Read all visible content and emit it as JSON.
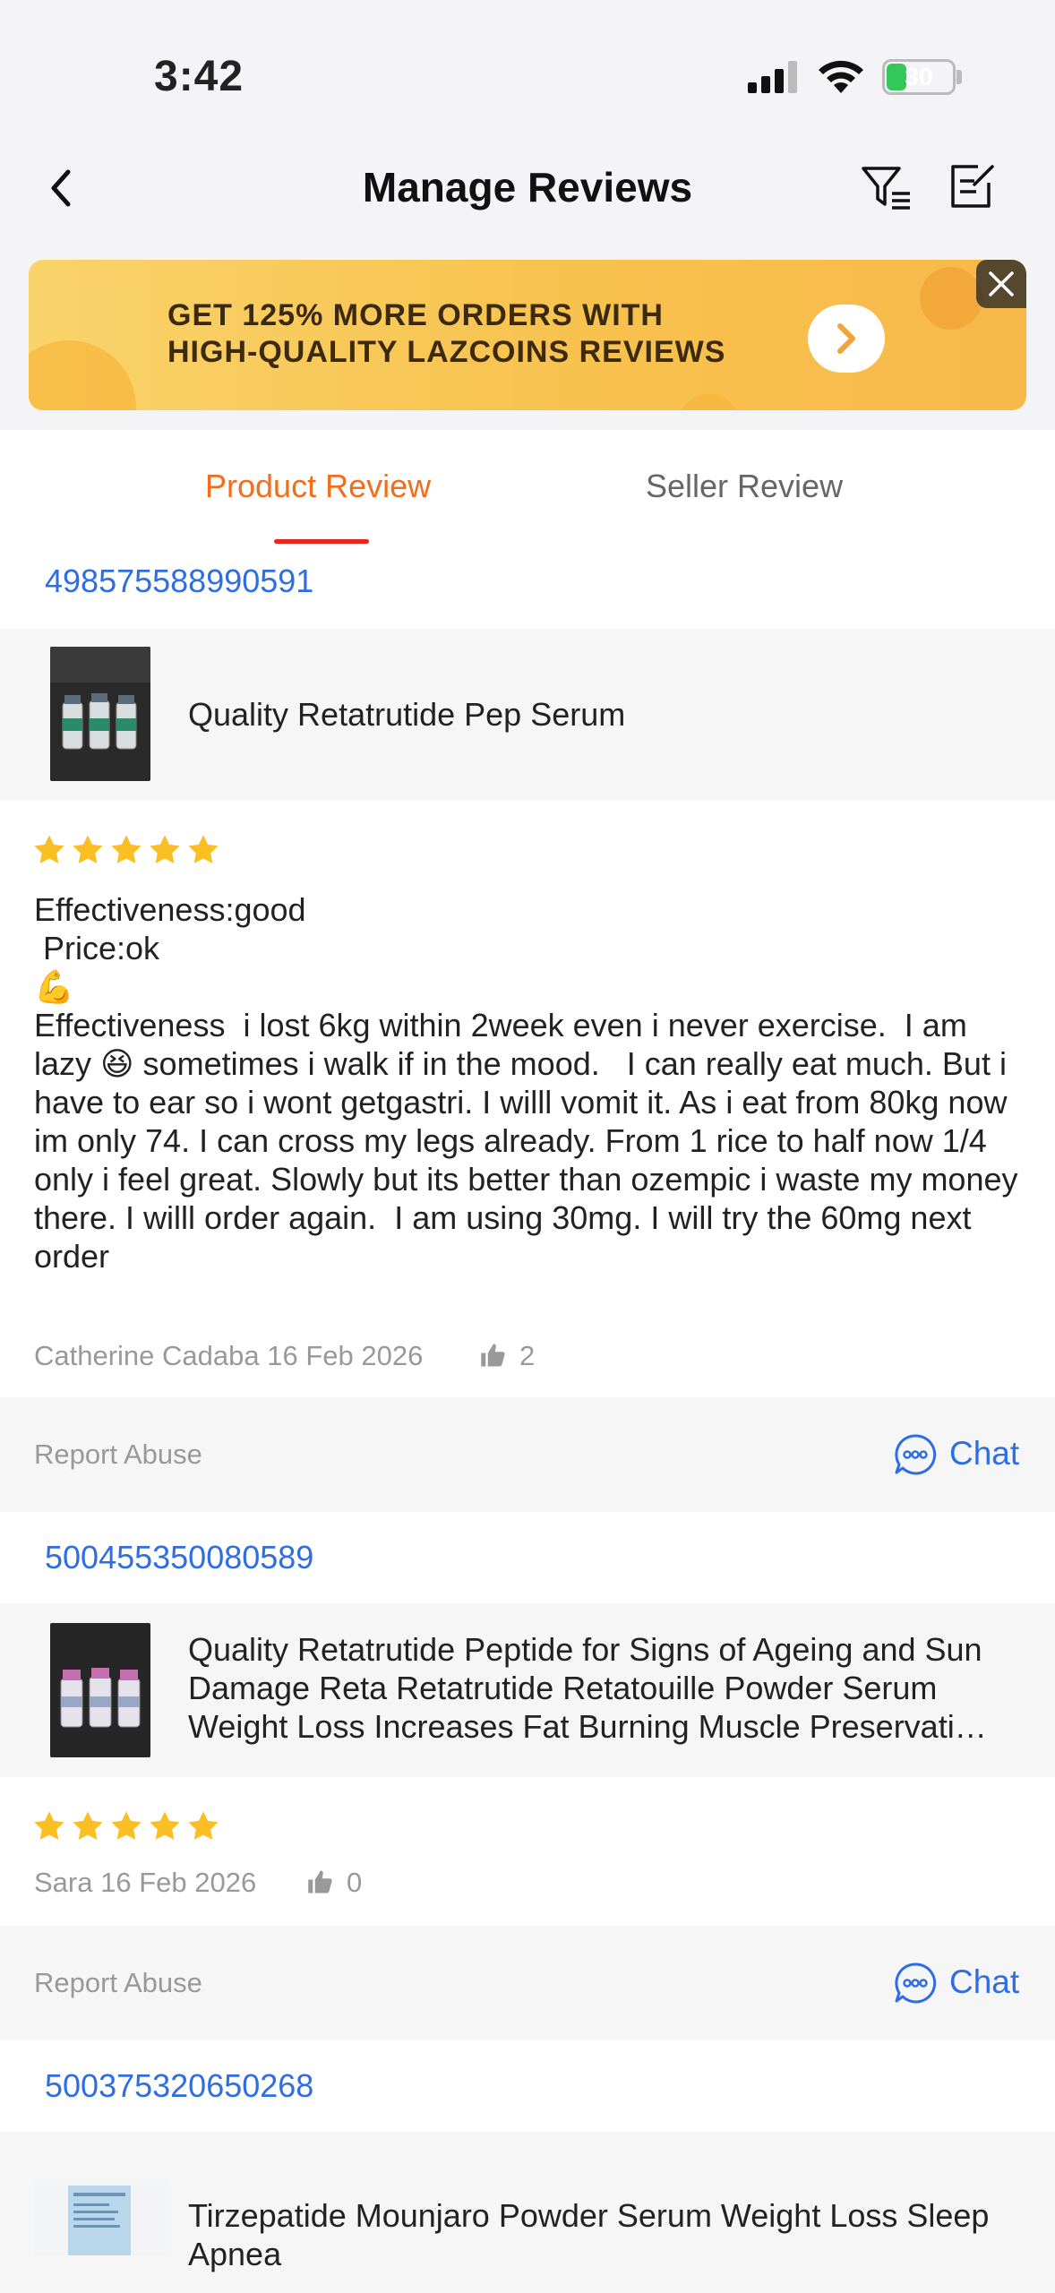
{
  "status_bar": {
    "time": "3:42",
    "battery": "30",
    "battery_level": 0.3
  },
  "header": {
    "title": "Manage Reviews"
  },
  "banner": {
    "line1": "GET 125% MORE ORDERS WITH",
    "line2": "HIGH-QUALITY LAZCOINS REVIEWS"
  },
  "tabs": [
    {
      "label": "Product Review",
      "active": true
    },
    {
      "label": "Seller Review",
      "active": false
    }
  ],
  "colors": {
    "accent_orange": "#f36d1a",
    "link_blue": "#2f6ee2",
    "star": "#fbbf24",
    "tab_underline": "#e8261c"
  },
  "reviews": [
    {
      "order_id": "498575588990591",
      "product_name": "Quality Retatrutide Pep Serum",
      "rating": 5,
      "text": "Effectiveness:good\n Price:ok\n💪\nEffectiveness  i lost 6kg within 2week even i never exercise.  I am lazy 😆 sometimes i walk if in the mood.   I can really eat much. But i have to ear so i wont getgastri. I willl vomit it. As i eat from 80kg now im only 74. I can cross my legs already. From 1 rice to half now 1/4 only i feel great. Slowly but its better than ozempic i waste my money there. I willl order again.  I am using 30mg. I will try the 60mg next order",
      "reviewer_date": "Catherine Cadaba 16 Feb 2026",
      "likes": "2",
      "report_label": "Report Abuse",
      "chat_label": "Chat"
    },
    {
      "order_id": "500455350080589",
      "product_name": "Quality Retatrutide Peptide for Signs of Ageing and Sun Damage Reta Retatrutide Retatouille Powder Serum Weight Loss Increases Fat Burning Muscle Preservati…",
      "rating": 5,
      "reviewer_date": "Sara 16 Feb 2026",
      "likes": "0",
      "report_label": "Report Abuse",
      "chat_label": "Chat"
    },
    {
      "order_id": "500375320650268",
      "product_name": "Tirzepatide Mounjaro Powder Serum Weight Loss Sleep Apnea"
    }
  ]
}
